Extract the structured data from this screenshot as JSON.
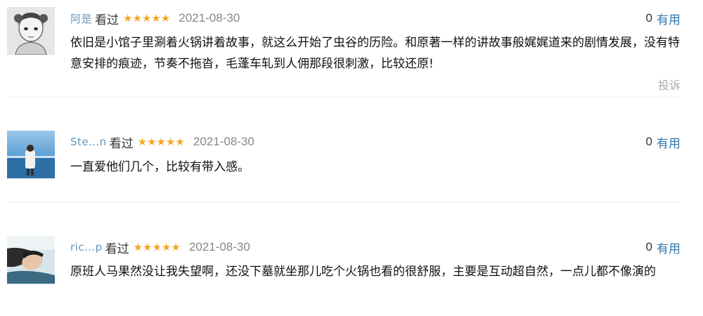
{
  "comments": [
    {
      "username": "阿是",
      "watched_label": "看过",
      "stars": "★★★★★",
      "date": "2021-08-30",
      "useful_count": "0",
      "useful_label": "有用",
      "content": "依旧是小馆子里涮着火锅讲着故事，就这么开始了虫谷的历险。和原著一样的讲故事般娓娓道来的剧情发展，没有特意安排的痕迹，节奏不拖沓，毛蓬车轧到人佣那段很刺激，比较还原!",
      "report_label": "投诉"
    },
    {
      "username": "Ste…n",
      "watched_label": "看过",
      "stars": "★★★★★",
      "date": "2021-08-30",
      "useful_count": "0",
      "useful_label": "有用",
      "content": "一直爱他们几个，比较有带入感。"
    },
    {
      "username": "ric…p",
      "watched_label": "看过",
      "stars": "★★★★★",
      "date": "2021-08-30",
      "useful_count": "0",
      "useful_label": "有用",
      "content": "原班人马果然没让我失望啊，还没下墓就坐那儿吃个火锅也看的很舒服，主要是互动超自然，一点儿都不像演的"
    }
  ]
}
